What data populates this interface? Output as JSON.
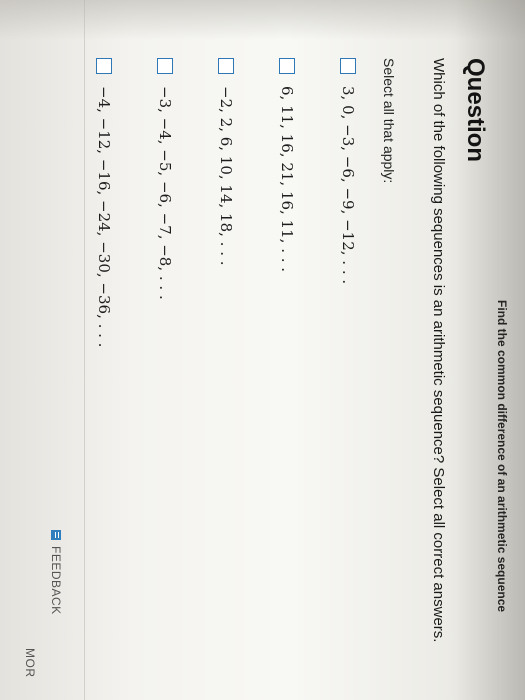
{
  "header": {
    "subtitle": "Find the common difference of an arithmetic sequence",
    "title": "Question"
  },
  "question": {
    "text": "Which of the following sequences is an arithmetic sequence? Select all correct answers.",
    "select_label": "Select all that apply:"
  },
  "options": [
    {
      "label": "3, 0, −3, −6, −9, −12, . . .",
      "checked": false
    },
    {
      "label": "6, 11, 16, 21, 16, 11, . . .",
      "checked": false
    },
    {
      "label": "−2, 2, 6, 10, 14, 18, . . .",
      "checked": false
    },
    {
      "label": "−3, −4, −5, −6, −7, −8, . . .",
      "checked": false
    },
    {
      "label": "−4, −12, −16, −24, −30, −36, . . .",
      "checked": false
    }
  ],
  "footer": {
    "feedback_label": "FEEDBACK",
    "more_label": "MOR"
  },
  "colors": {
    "checkbox_border": "#2f78b7",
    "feedback_icon": "#2f7fbf"
  }
}
